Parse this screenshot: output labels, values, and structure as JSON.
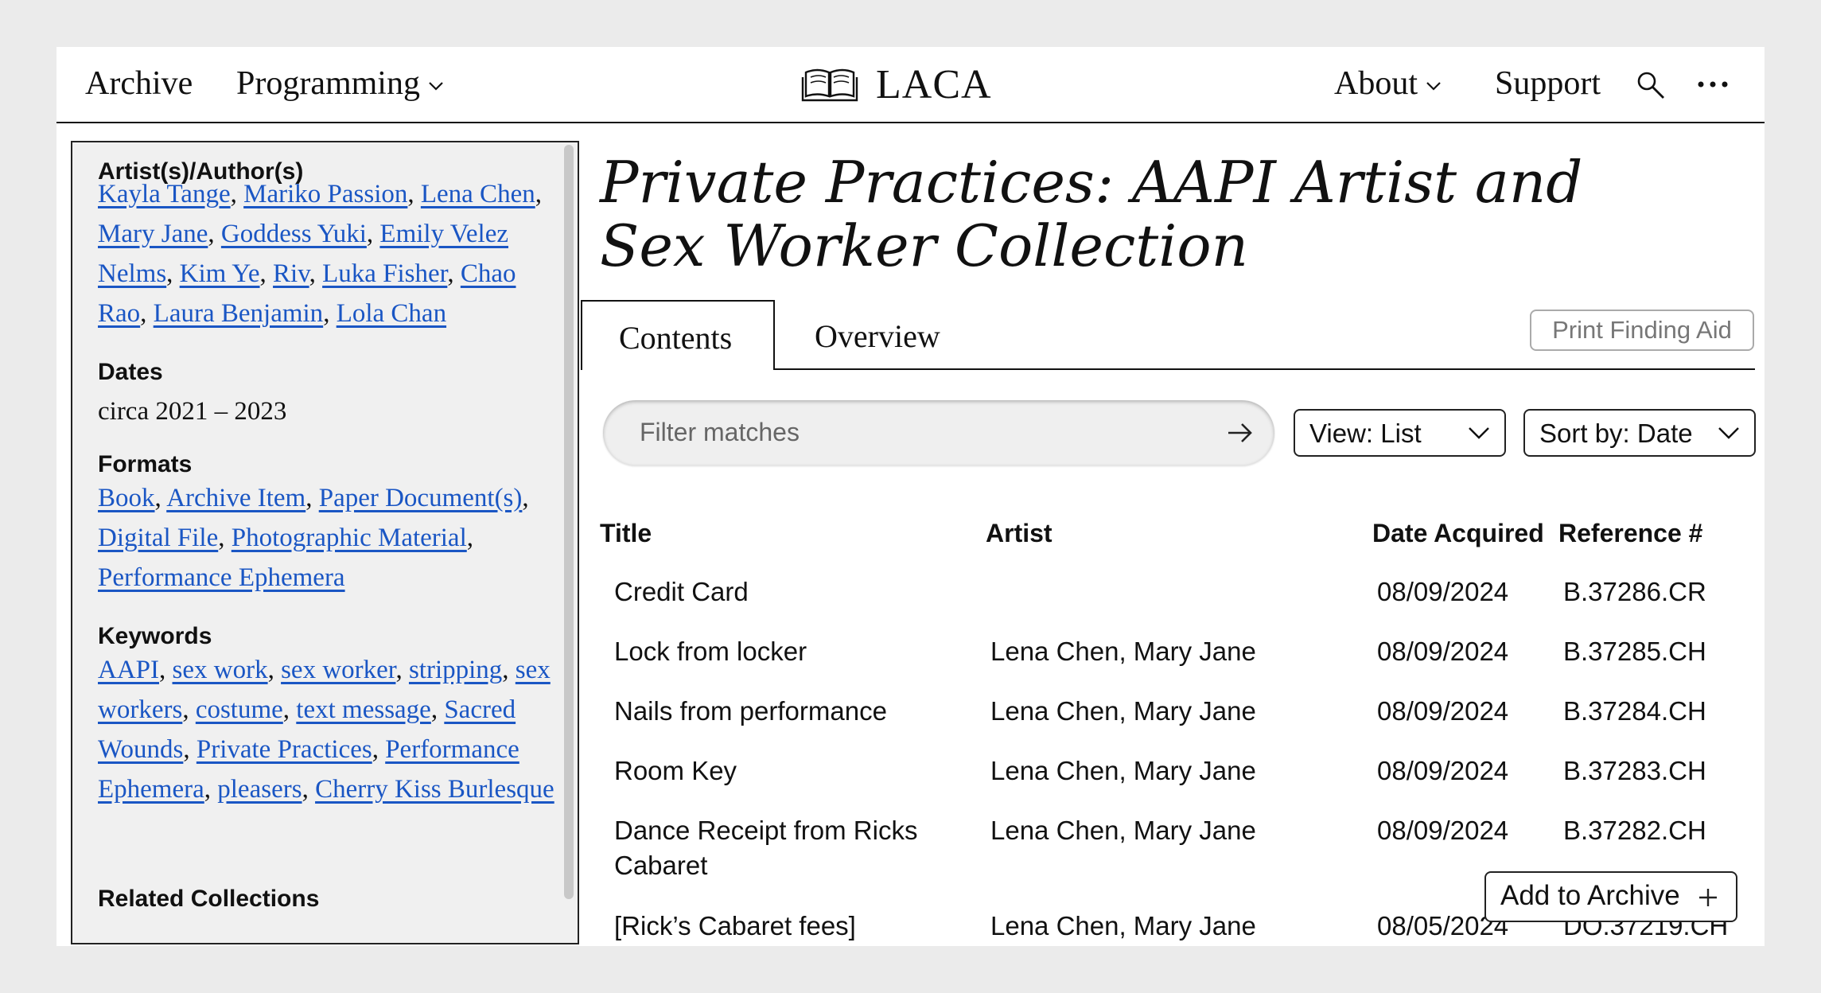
{
  "header": {
    "nav_left": [
      "Archive",
      "Programming"
    ],
    "logo_text": "LACA",
    "nav_right": [
      "About",
      "Support"
    ]
  },
  "sidebar": {
    "artists_heading": "Artist(s)/Author(s)",
    "artists": [
      "Kayla Tange",
      "Mariko Passion",
      "Lena Chen",
      "Mary Jane",
      "Goddess Yuki",
      "Emily Velez Nelms",
      "Kim Ye",
      "Riv",
      "Luka Fisher",
      "Chao Rao",
      "Laura Benjamin",
      "Lola Chan"
    ],
    "dates_heading": "Dates",
    "dates_value": "circa 2021 – 2023",
    "formats_heading": "Formats",
    "formats": [
      "Book",
      "Archive Item",
      "Paper Document(s)",
      "Digital File",
      "Photographic Material",
      "Performance Ephemera"
    ],
    "keywords_heading": "Keywords",
    "keywords": [
      "AAPI",
      "sex work",
      "sex worker",
      "stripping",
      "sex workers",
      "costume",
      "text message",
      "Sacred Wounds",
      "Private Practices",
      "Performance Ephemera",
      "pleasers",
      "Cherry Kiss Burlesque"
    ],
    "related_heading": "Related Collections"
  },
  "main": {
    "title": "Private Practices: AAPI Artist and Sex Worker Collection",
    "tabs": [
      {
        "label": "Contents",
        "active": true
      },
      {
        "label": "Overview",
        "active": false
      }
    ],
    "print_label": "Print Finding Aid",
    "filter_placeholder": "Filter matches",
    "view_label": "View: List",
    "sort_label": "Sort by: Date",
    "columns": [
      "Title",
      "Artist",
      "Date Acquired",
      "Reference #"
    ],
    "rows": [
      {
        "title": "Credit Card",
        "artist": "",
        "date": "08/09/2024",
        "ref": "B.37286.CR"
      },
      {
        "title": "Lock from locker",
        "artist": "Lena Chen, Mary Jane",
        "date": "08/09/2024",
        "ref": "B.37285.CH"
      },
      {
        "title": "Nails from performance",
        "artist": "Lena Chen, Mary Jane",
        "date": "08/09/2024",
        "ref": "B.37284.CH"
      },
      {
        "title": "Room Key",
        "artist": "Lena Chen, Mary Jane",
        "date": "08/09/2024",
        "ref": "B.37283.CH"
      },
      {
        "title": "Dance Receipt from Ricks Cabaret",
        "artist": "Lena Chen, Mary Jane",
        "date": "08/09/2024",
        "ref": "B.37282.CH"
      },
      {
        "title": "[Rick’s Cabaret fees]",
        "artist": "Lena Chen, Mary Jane",
        "date": "08/05/2024",
        "ref": "DO.37219.CH"
      }
    ],
    "add_label": "Add to Archive"
  },
  "icons": [
    "book-logo-icon",
    "chevron-down-icon",
    "search-icon",
    "more-icon",
    "arrow-right-icon",
    "plus-icon"
  ]
}
